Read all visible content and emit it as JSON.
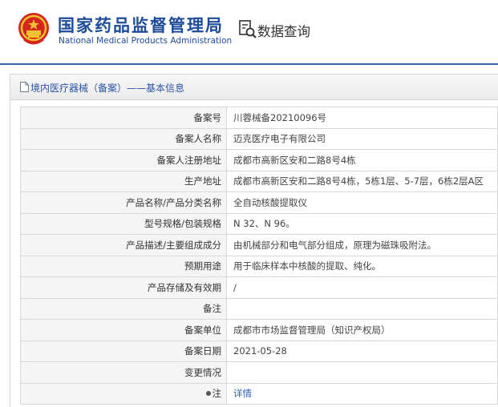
{
  "header": {
    "org_name_cn": "国家药品监督管理局",
    "org_name_en": "National Medical Products Administration",
    "query_label": "数据查询",
    "brand_color": "#1d4b9a"
  },
  "panel": {
    "title": "境内医疗器械（备案）——基本信息"
  },
  "rows": [
    {
      "label": "备案号",
      "value": "川蓉械备20210096号"
    },
    {
      "label": "备案人名称",
      "value": "迈克医疗电子有限公司"
    },
    {
      "label": "备案人注册地址",
      "value": "成都市高新区安和二路8号4栋"
    },
    {
      "label": "生产地址",
      "value": "成都市高新区安和二路8号4栋，5栋1层、5-7层，6栋2层A区"
    },
    {
      "label": "产品名称/产品分类名称",
      "value": "全自动核酸提取仪"
    },
    {
      "label": "型号规格/包装规格",
      "value": "N 32、N 96。"
    },
    {
      "label": "产品描述/主要组成成分",
      "value": "由机械部分和电气部分组成，原理为磁珠吸附法。"
    },
    {
      "label": "预期用途",
      "value": "用于临床样本中核酸的提取、纯化。"
    },
    {
      "label": "产品存储及有效期",
      "value": "/"
    },
    {
      "label": "备注",
      "value": ""
    },
    {
      "label": "备案单位",
      "value": "成都市市场监督管理局（知识产权局）"
    },
    {
      "label": "备案日期",
      "value": "2021-05-28"
    },
    {
      "label": "变更情况",
      "value": ""
    }
  ],
  "note_row": {
    "label": "注",
    "link": "详情"
  }
}
